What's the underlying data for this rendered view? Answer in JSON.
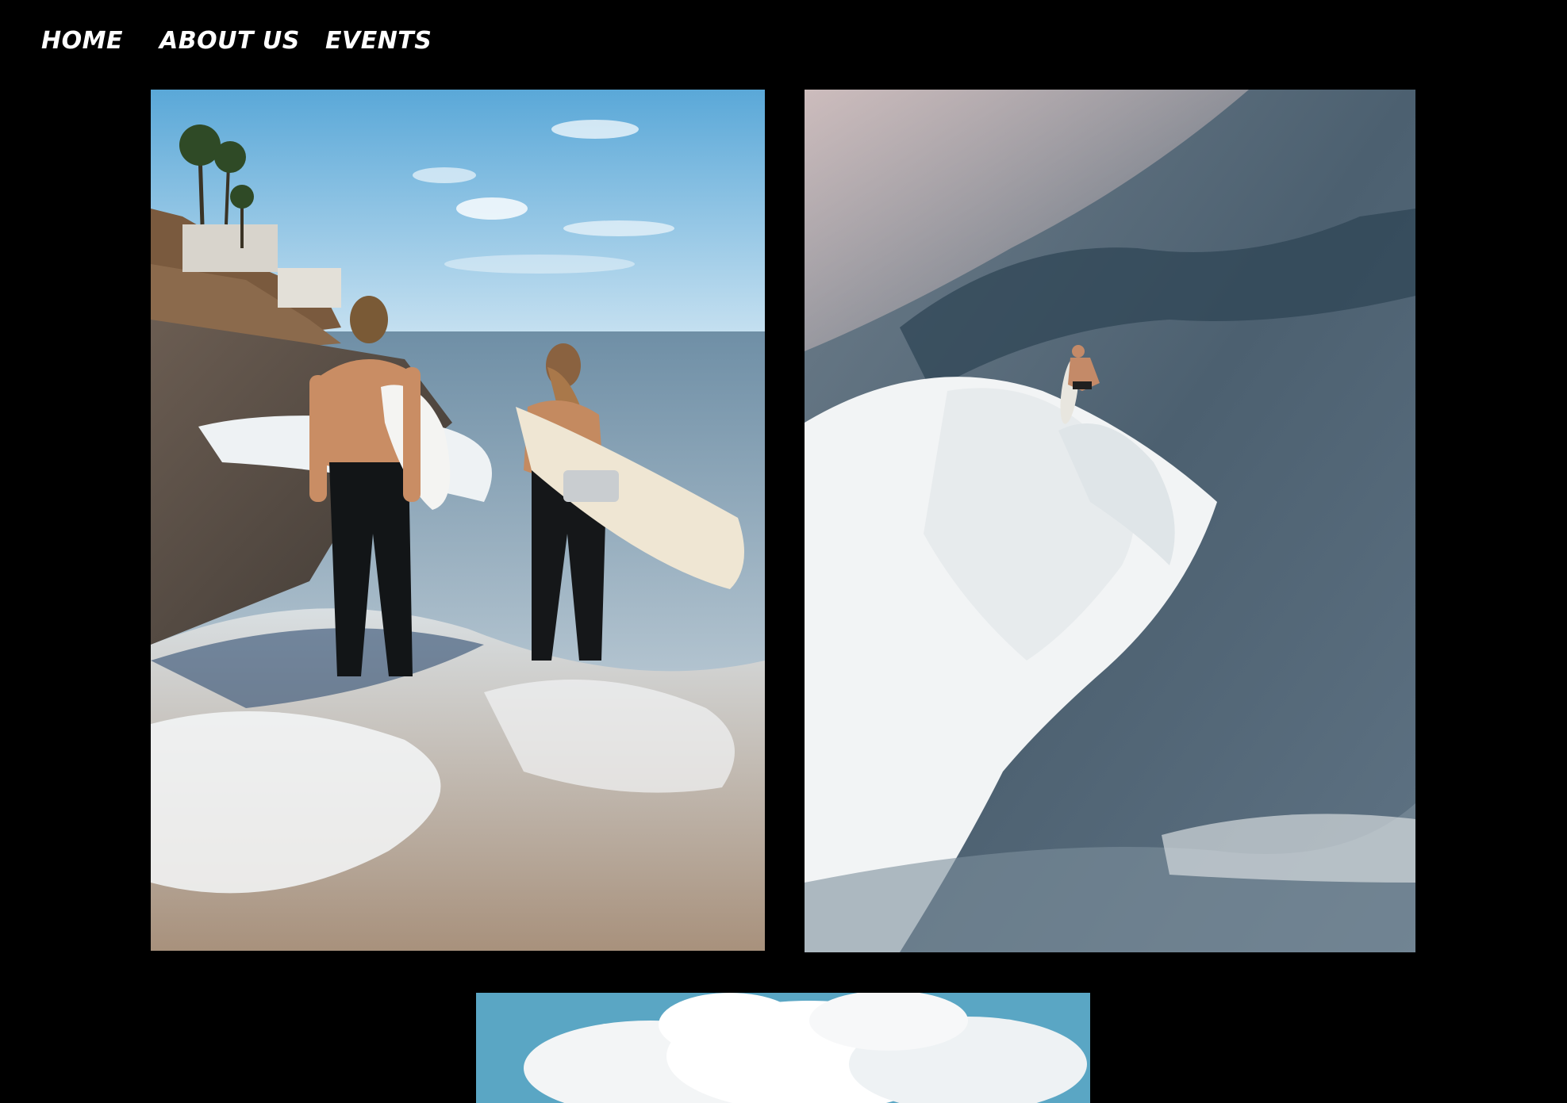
{
  "nav": {
    "items": [
      {
        "label": "HOME"
      },
      {
        "label": "ABOUT US"
      },
      {
        "label": "EVENTS"
      }
    ]
  },
  "gallery": {
    "photos": [
      {
        "subject": "two surfers walking into the surf carrying boards"
      },
      {
        "subject": "surfer riding a breaking wave from above"
      },
      {
        "subject": "clouds over blue sky"
      }
    ]
  },
  "colors": {
    "background": "#000000",
    "nav_text": "#ffffff"
  }
}
